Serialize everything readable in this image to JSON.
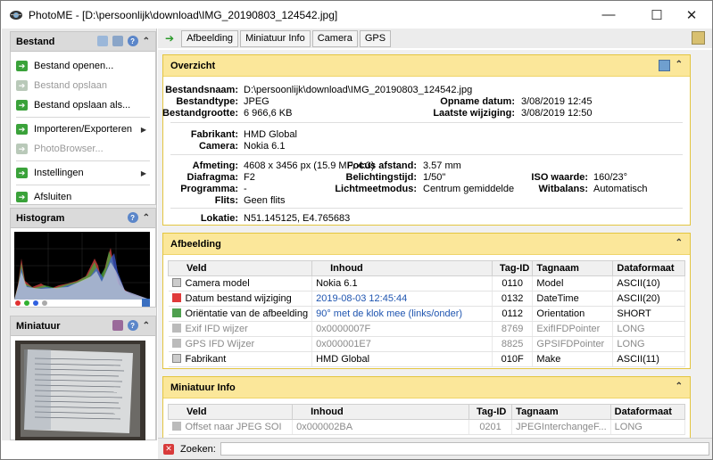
{
  "window": {
    "title": "PhotoME - [D:\\persoonlijk\\download\\IMG_20190803_124542.jpg]",
    "minimize": "—",
    "maximize": "☐",
    "close": "✕"
  },
  "left": {
    "bestand": {
      "title": "Bestand",
      "items": [
        {
          "label": "Bestand openen...",
          "enabled": true
        },
        {
          "label": "Bestand opslaan",
          "enabled": false
        },
        {
          "label": "Bestand opslaan als...",
          "enabled": true
        },
        {
          "label": "Importeren/Exporteren",
          "enabled": true
        },
        {
          "label": "PhotoBrowser...",
          "enabled": false
        },
        {
          "label": "Instellingen",
          "enabled": true
        },
        {
          "label": "Afsluiten",
          "enabled": true
        }
      ]
    },
    "histogram": {
      "title": "Histogram"
    },
    "miniatuur": {
      "title": "Miniatuur"
    }
  },
  "toolbar": {
    "tabs": [
      "Afbeelding",
      "Miniatuur Info",
      "Camera",
      "GPS"
    ]
  },
  "overzicht": {
    "title": "Overzicht",
    "bestandsnaam_l": "Bestandsnaam:",
    "bestandsnaam": "D:\\persoonlijk\\download\\IMG_20190803_124542.jpg",
    "bestandtype_l": "Bestandtype:",
    "bestandtype": "JPEG",
    "bestandgrootte_l": "Bestandgrootte:",
    "bestandgrootte": "6 966,6 KB",
    "opname_l": "Opname datum:",
    "opname": "3/08/2019 12:45",
    "wijziging_l": "Laatste wijziging:",
    "wijziging": "3/08/2019 12:50",
    "fabrikant_l": "Fabrikant:",
    "fabrikant": "HMD Global",
    "camera_l": "Camera:",
    "camera": "Nokia 6.1",
    "afmeting_l": "Afmeting:",
    "afmeting": "4608 x 3456 px (15.9 MP, 4:3)",
    "diafragma_l": "Diafragma:",
    "diafragma": "F2",
    "programma_l": "Programma:",
    "programma": "-",
    "flits_l": "Flits:",
    "flits": "Geen flits",
    "focus_l": "Focus afstand:",
    "focus": "3.57 mm",
    "belichting_l": "Belichtingstijd:",
    "belichting": "1/50\"",
    "lichtmeet_l": "Lichtmeetmodus:",
    "lichtmeet": "Centrum gemiddelde",
    "iso_l": "ISO waarde:",
    "iso": "160/23°",
    "witbalans_l": "Witbalans:",
    "witbalans": "Automatisch",
    "locatie_l": "Lokatie:",
    "locatie": "N51.145125, E4.765683"
  },
  "afbeelding": {
    "title": "Afbeelding",
    "columns": [
      "Veld",
      "Inhoud",
      "Tag-ID",
      "Tagnaam",
      "Dataformaat"
    ],
    "rows": [
      {
        "veld": "Camera model",
        "inhoud": "Nokia 6.1",
        "tag": "0110",
        "naam": "Model",
        "fmt": "ASCII(10)"
      },
      {
        "veld": "Datum bestand wijziging",
        "inhoud": "2019-08-03 12:45:44",
        "tag": "0132",
        "naam": "DateTime",
        "fmt": "ASCII(20)"
      },
      {
        "veld": "Oriëntatie van de afbeelding",
        "inhoud": "90° met de klok mee (links/onder)",
        "tag": "0112",
        "naam": "Orientation",
        "fmt": "SHORT"
      },
      {
        "veld": "Exif IFD wijzer",
        "inhoud": "0x0000007F",
        "tag": "8769",
        "naam": "ExifIFDPointer",
        "fmt": "LONG"
      },
      {
        "veld": "GPS IFD Wijzer",
        "inhoud": "0x000001E7",
        "tag": "8825",
        "naam": "GPSIFDPointer",
        "fmt": "LONG"
      },
      {
        "veld": "Fabrikant",
        "inhoud": "HMD Global",
        "tag": "010F",
        "naam": "Make",
        "fmt": "ASCII(11)"
      }
    ]
  },
  "miniatuur_info": {
    "title": "Miniatuur Info",
    "columns": [
      "Veld",
      "Inhoud",
      "Tag-ID",
      "Tagnaam",
      "Dataformaat"
    ],
    "rows": [
      {
        "veld": "Offset naar JPEG SOI",
        "inhoud": "0x000002BA",
        "tag": "0201",
        "naam": "JPEGInterchangeF...",
        "fmt": "LONG"
      }
    ]
  },
  "search": {
    "label": "Zoeken:",
    "value": ""
  },
  "colors": {
    "accent_yellow": "#fbe79a",
    "link_blue": "#1f55b0",
    "menu_green": "#3aa23a"
  }
}
